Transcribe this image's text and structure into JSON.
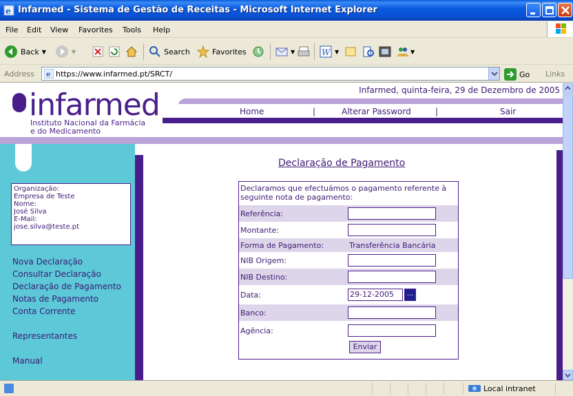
{
  "window": {
    "title": "Infarmed - Sistema de Gestão de Receitas - Microsoft Internet Explorer"
  },
  "menu": {
    "items": [
      "File",
      "Edit",
      "View",
      "Favorites",
      "Tools",
      "Help"
    ]
  },
  "toolbar": {
    "back_label": "Back",
    "search_label": "Search",
    "favorites_label": "Favorites"
  },
  "address": {
    "label": "Address",
    "url": "https://www.infarmed.pt/SRCT/",
    "go_label": "Go",
    "links_label": "Links"
  },
  "header": {
    "date_text": "Infarmed, quinta-feira, 29 de Dezembro de 2005",
    "logo_word": "infarmed",
    "logo_sub_line1": "Instituto Nacional da Farmácia",
    "logo_sub_line2": "e do Medicamento",
    "nav": {
      "home": "Home",
      "sep1": "|",
      "change_password": "Alterar Password",
      "sep2": "|",
      "logout": "Sair"
    }
  },
  "user": {
    "org_label": "Organização:",
    "org_value": "Empresa de Teste",
    "name_label": "Nome:",
    "name_value": "José Silva",
    "email_label": "E-Mail:",
    "email_value": "jose.silva@teste.pt"
  },
  "sidebar": {
    "items": [
      "Nova Declaração",
      "Consultar Declaração",
      "Declaração de Pagamento",
      "Notas de Pagamento",
      "Conta Corrente",
      "Representantes",
      "Manual"
    ]
  },
  "form": {
    "title": "Declaração de Pagamento",
    "intro": "Declaramos que efectuámos o pagamento referente à seguinte nota de pagamento:",
    "fields": {
      "referencia_label": "Referência:",
      "referencia_value": "",
      "montante_label": "Montante:",
      "montante_value": "",
      "forma_label": "Forma de Pagamento:",
      "forma_value": "Transferência Bancária",
      "nib_origem_label": "NIB Origem:",
      "nib_origem_value": "",
      "nib_destino_label": "NIB Destino:",
      "nib_destino_value": "",
      "data_label": "Data:",
      "data_value": "29-12-2005",
      "date_picker": "...",
      "banco_label": "Banco:",
      "banco_value": "",
      "agencia_label": "Agência:",
      "agencia_value": ""
    },
    "submit_label": "Enviar"
  },
  "status": {
    "zone": "Local intranet"
  },
  "colors": {
    "brand_purple": "#4a1e8a",
    "light_purple": "#b9a3d8",
    "sidebar_cyan": "#5cc8d8",
    "row_shade": "#ddd6ea"
  }
}
